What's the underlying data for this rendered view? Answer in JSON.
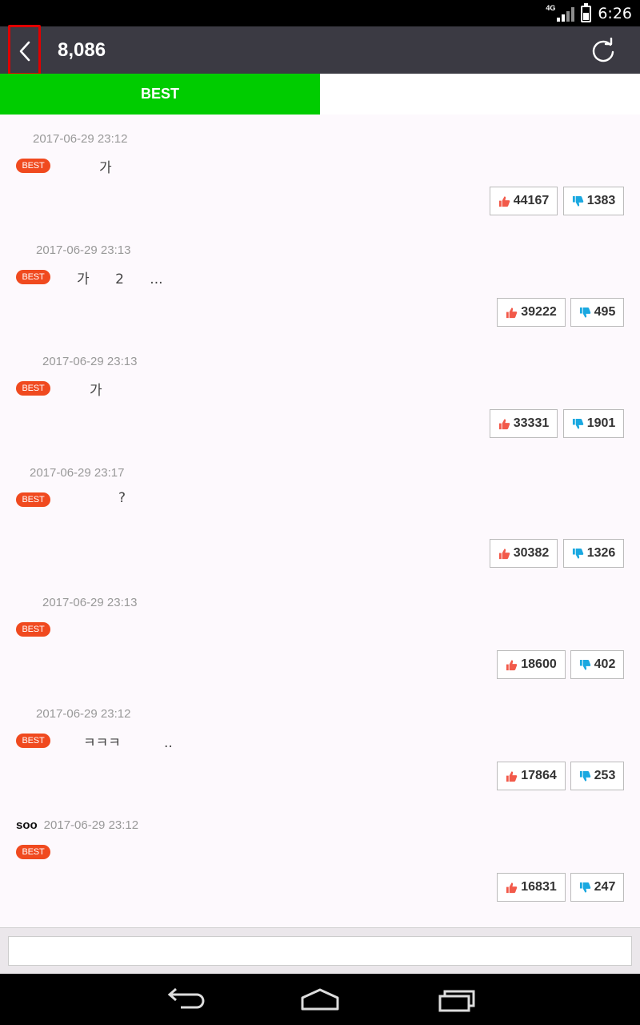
{
  "status_bar": {
    "network": "4G",
    "time": "6:26"
  },
  "app_bar": {
    "title": "8,086"
  },
  "tabs": [
    {
      "label": "BEST"
    }
  ],
  "badge_label": "BEST",
  "comments": [
    {
      "user": "",
      "date": "2017-06-29 23:12",
      "text": "가",
      "likes": "44167",
      "dislikes": "1383"
    },
    {
      "user": "",
      "date": "2017-06-29 23:13",
      "text": "가      2      ...",
      "likes": "39222",
      "dislikes": "495"
    },
    {
      "user": "",
      "date": "2017-06-29 23:13",
      "text": "가",
      "likes": "33331",
      "dislikes": "1901"
    },
    {
      "user": "",
      "date": "2017-06-29 23:17",
      "text": "?",
      "likes": "30382",
      "dislikes": "1326"
    },
    {
      "user": "",
      "date": "2017-06-29 23:13",
      "text": "",
      "likes": "18600",
      "dislikes": "402"
    },
    {
      "user": "",
      "date": "2017-06-29 23:12",
      "text": "ㅋㅋㅋ          ..",
      "likes": "17864",
      "dislikes": "253"
    },
    {
      "user": "soo",
      "date": "2017-06-29 23:12",
      "text": "",
      "likes": "16831",
      "dislikes": "247"
    }
  ],
  "input": {
    "value": "",
    "placeholder": ""
  },
  "icons": {
    "back": "chevron-left-icon",
    "refresh": "refresh-icon",
    "like": "thumbs-up-icon",
    "dislike": "thumbs-down-icon",
    "nav_back": "nav-back-icon",
    "nav_home": "nav-home-icon",
    "nav_recents": "nav-recents-icon"
  },
  "colors": {
    "tab_active": "#00cc00",
    "app_bar": "#3b3a43",
    "best_badge": "#f04a1f",
    "like": "#f25a4a",
    "dislike": "#1aa8e0"
  }
}
